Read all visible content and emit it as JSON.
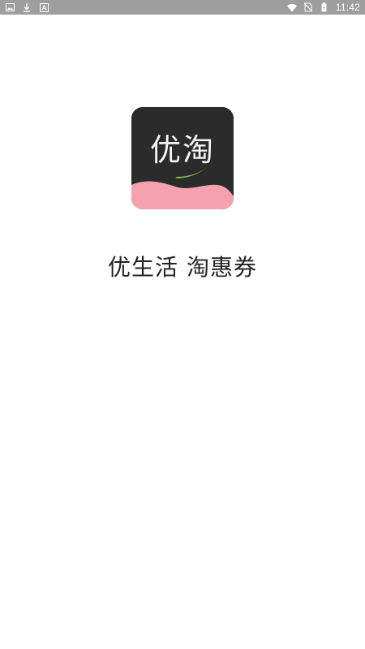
{
  "status_bar": {
    "time": "11:42",
    "left_icons": [
      "image-icon",
      "download-icon",
      "keyboard-a-icon"
    ],
    "right_icons": [
      "wifi-icon",
      "no-sim-icon",
      "battery-icon"
    ],
    "background_color": "#9e9e9e"
  },
  "splash": {
    "app_icon_text": "优淘",
    "tagline": "优生活 淘惠券",
    "icon_bg_color": "#2b2b2b",
    "icon_wave_color": "#f4a3ae",
    "icon_swoosh_color": "#7cc24a"
  }
}
